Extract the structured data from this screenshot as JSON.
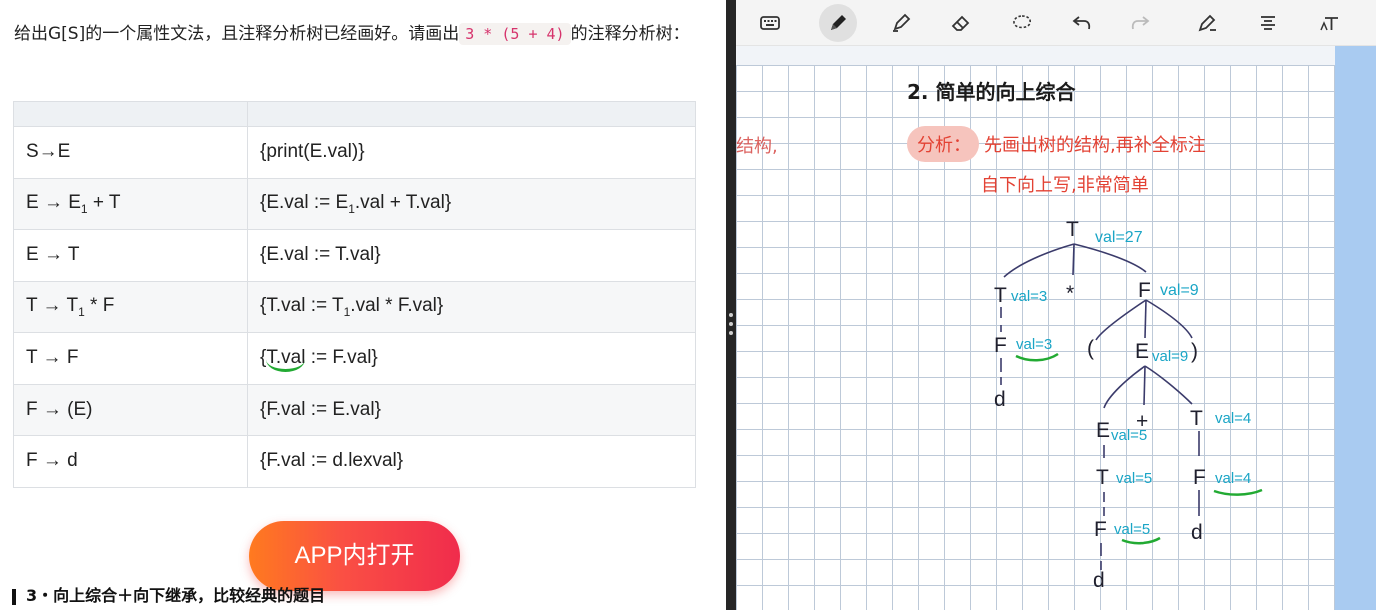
{
  "question": {
    "text_before": "给出G[S]的一个属性文法，且注释分析树已经画好。请画出",
    "expression": "3 * (5 + 4)",
    "text_after": "的注释分析树："
  },
  "rules_table": {
    "rows": [
      {
        "prod": "S→E",
        "action": "{print(E.val)}"
      },
      {
        "prod_lhs": "E → E",
        "prod_sub": "1",
        "prod_rhs": " + T",
        "action_a": "{E.val := E",
        "action_sub": "1",
        "action_b": ".val + T.val}"
      },
      {
        "prod": "E → T",
        "action": "{E.val := T.val}"
      },
      {
        "prod_lhs": "T → T",
        "prod_sub": "1",
        "prod_rhs": " * F",
        "action_a": "{T.val := T",
        "action_sub": "1",
        "action_b": ".val * F.val}"
      },
      {
        "prod": "T → F",
        "action_a": "{",
        "action_u": "T.val",
        "action_b": " := F.val}"
      },
      {
        "prod": "F → (E)",
        "action": "{F.val := E.val}"
      },
      {
        "prod": "F → d",
        "action": "{F.val := d.lexval}"
      }
    ]
  },
  "app_button": {
    "label": "APP内打开"
  },
  "next_section": {
    "label": "3・向上综合＋向下继承，比较经典的题目"
  },
  "toolbar": {
    "tools": [
      "keyboard-icon",
      "pen-icon",
      "highlighter-icon",
      "eraser-icon",
      "lasso-icon",
      "undo-icon",
      "redo-icon",
      "shape-pen-icon",
      "text-align-icon",
      "text-tool-icon"
    ]
  },
  "notes": {
    "title": "2. 简单的向上综合",
    "ghost": "结构,",
    "analysis_label": "分析：",
    "analysis_line1": "先画出树的结构,再补全标注",
    "analysis_line2": "自下向上写,非常简单",
    "tree": {
      "root": {
        "sym": "T",
        "val": "val=27"
      },
      "left_t": {
        "sym": "T",
        "val": "val=3"
      },
      "times": "*",
      "right_f": {
        "sym": "F",
        "val": "val=9"
      },
      "left_f": {
        "sym": "F",
        "val": "val=3"
      },
      "lparen": "(",
      "inner_e": {
        "sym": "E",
        "val": "val=9"
      },
      "rparen": ")",
      "d1": "d",
      "e5": {
        "sym": "E",
        "val": "val=5"
      },
      "plus": "+",
      "t4": {
        "sym": "T",
        "val": "val=4"
      },
      "t5": {
        "sym": "T",
        "val": "val=5"
      },
      "f4": {
        "sym": "F",
        "val": "val=4"
      },
      "f5": {
        "sym": "F",
        "val": "val=5"
      },
      "d2": "d",
      "d3": "d"
    }
  }
}
